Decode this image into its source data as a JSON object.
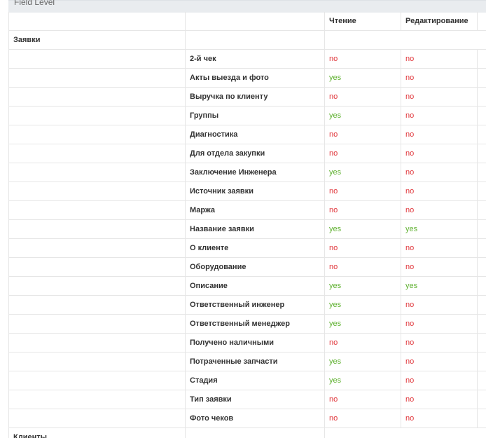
{
  "panel": {
    "title": "Field Level"
  },
  "columns": {
    "read": "Чтение",
    "edit": "Редактирование"
  },
  "sections": [
    {
      "name": "Заявки",
      "fields": [
        {
          "name": "2-й чек",
          "read": "no",
          "edit": "no"
        },
        {
          "name": "Акты выезда и фото",
          "read": "yes",
          "edit": "no"
        },
        {
          "name": "Выручка по клиенту",
          "read": "no",
          "edit": "no"
        },
        {
          "name": "Группы",
          "read": "yes",
          "edit": "no"
        },
        {
          "name": "Диагностика",
          "read": "no",
          "edit": "no"
        },
        {
          "name": "Для отдела закупки",
          "read": "no",
          "edit": "no"
        },
        {
          "name": "Заключение Инженера",
          "read": "yes",
          "edit": "no"
        },
        {
          "name": "Источник заявки",
          "read": "no",
          "edit": "no"
        },
        {
          "name": "Маржа",
          "read": "no",
          "edit": "no"
        },
        {
          "name": "Название заявки",
          "read": "yes",
          "edit": "yes"
        },
        {
          "name": "О клиенте",
          "read": "no",
          "edit": "no"
        },
        {
          "name": "Оборудование",
          "read": "no",
          "edit": "no"
        },
        {
          "name": "Описание",
          "read": "yes",
          "edit": "yes"
        },
        {
          "name": "Ответственный инженер",
          "read": "yes",
          "edit": "no"
        },
        {
          "name": "Ответственный менеджер",
          "read": "yes",
          "edit": "no"
        },
        {
          "name": "Получено наличными",
          "read": "no",
          "edit": "no"
        },
        {
          "name": "Потраченные запчасти",
          "read": "yes",
          "edit": "no"
        },
        {
          "name": "Стадия",
          "read": "yes",
          "edit": "no"
        },
        {
          "name": "Тип заявки",
          "read": "no",
          "edit": "no"
        },
        {
          "name": "Фото чеков",
          "read": "no",
          "edit": "no"
        }
      ]
    },
    {
      "name": "Клиенты",
      "fields": []
    }
  ],
  "colors": {
    "yes": "#5fb130",
    "no": "#e0363b",
    "header_bg": "#e9ecef",
    "grid_line": "#e6e6e6"
  }
}
